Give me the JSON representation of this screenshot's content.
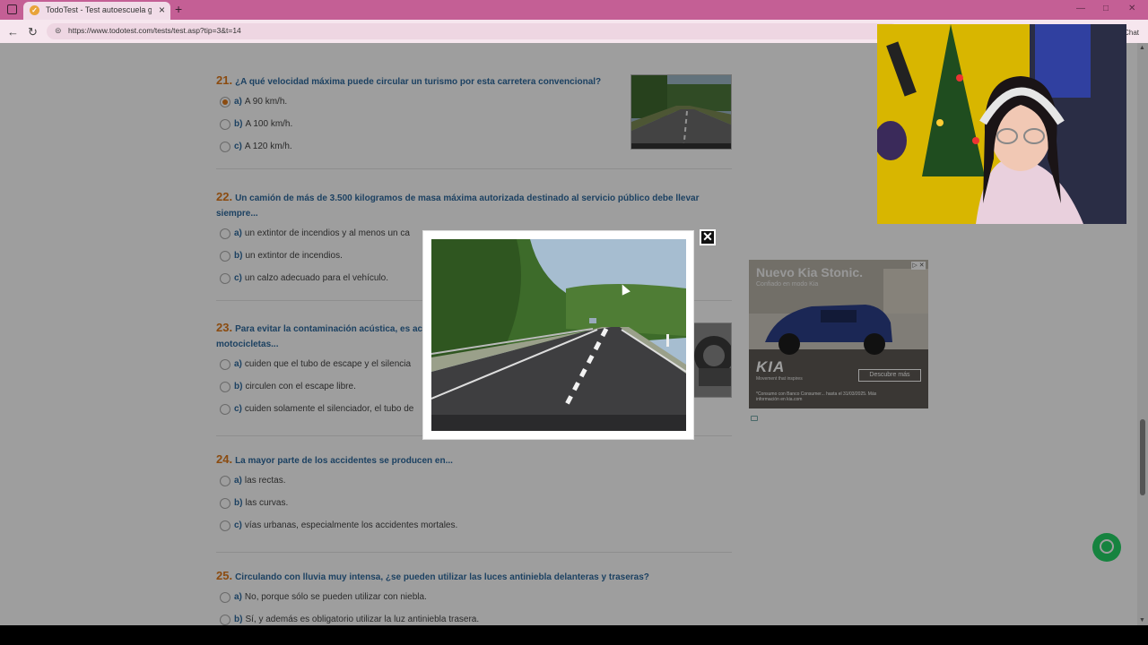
{
  "browser": {
    "tab_title": "TodoTest - Test autoescuela gratis",
    "url": "https://www.todotest.com/tests/test.asp?tip=3&t=14",
    "chat_label": "Chat"
  },
  "questions": [
    {
      "number": "21.",
      "text": "¿A qué velocidad máxima puede circular un turismo por esta carretera convencional?",
      "options": [
        {
          "letter": "a)",
          "text": "A 90 km/h.",
          "selected": true
        },
        {
          "letter": "b)",
          "text": "A 100 km/h.",
          "selected": false
        },
        {
          "letter": "c)",
          "text": "A 120 km/h.",
          "selected": false
        }
      ]
    },
    {
      "number": "22.",
      "text": "Un camión de más de 3.500 kilogramos de masa máxima autorizada destinado al servicio público debe llevar siempre...",
      "options": [
        {
          "letter": "a)",
          "text": "un extintor de incendios y al menos un ca",
          "selected": false
        },
        {
          "letter": "b)",
          "text": "un extintor de incendios.",
          "selected": false
        },
        {
          "letter": "c)",
          "text": "un calzo adecuado para el vehículo.",
          "selected": false
        }
      ]
    },
    {
      "number": "23.",
      "text": "Para evitar la contaminación acústica, es ac",
      "text_line2": "motocicletas...",
      "options": [
        {
          "letter": "a)",
          "text": "cuiden que el tubo de escape y el silencia",
          "selected": false
        },
        {
          "letter": "b)",
          "text": "circulen con el escape libre.",
          "selected": false
        },
        {
          "letter": "c)",
          "text": "cuiden solamente el silenciador, el tubo de",
          "selected": false
        }
      ]
    },
    {
      "number": "24.",
      "text": "La mayor parte de los accidentes se producen en...",
      "options": [
        {
          "letter": "a)",
          "text": "las rectas.",
          "selected": false
        },
        {
          "letter": "b)",
          "text": "las curvas.",
          "selected": false
        },
        {
          "letter": "c)",
          "text": "vías urbanas, especialmente los accidentes mortales.",
          "selected": false
        }
      ]
    },
    {
      "number": "25.",
      "text": "Circulando con lluvia muy intensa, ¿se pueden utilizar las luces antiniebla delanteras y traseras?",
      "options": [
        {
          "letter": "a)",
          "text": "No, porque sólo se pueden utilizar con niebla.",
          "selected": false
        },
        {
          "letter": "b)",
          "text": "Sí, y además es obligatorio utilizar la luz antiniebla trasera.",
          "selected": false
        }
      ]
    }
  ],
  "ad": {
    "title": "Nuevo Kia Stonic.",
    "subtitle": "Confiado en modo Kia",
    "logo": "KIA",
    "logo_sub": "Movement that inspires",
    "button": "Descubre más",
    "legal": "*Consumo con Banco Consumer... hasta el 31/03/2025. Más información en kia.com",
    "info": "▷ ✕"
  },
  "modal": {
    "close_symbol": "✕"
  },
  "colors": {
    "tab_bar": "#c45f95",
    "question_title": "#2e6a9e",
    "question_number": "#e07a1a",
    "overlay": "rgba(0,0,0,0.38)"
  }
}
